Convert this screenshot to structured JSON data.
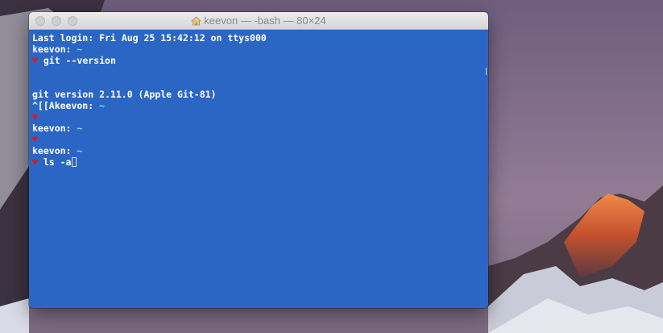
{
  "colors": {
    "terminal_bg": "#2c66c5",
    "text": "#ffffff",
    "tilde": "#7fe0ef",
    "heart": "#c8202a"
  },
  "window": {
    "title": "keevon — -bash — 80×24",
    "title_icon": "home-icon"
  },
  "terminal": {
    "lines": [
      {
        "text": "Last login: Fri Aug 25 15:42:12 on ttys000"
      },
      {
        "prefix": "keevon: ",
        "tilde": "~"
      },
      {
        "heart": "♥",
        "text": " git --version"
      },
      {
        "text": ""
      },
      {
        "text": ""
      },
      {
        "text": "git version 2.11.0 (Apple Git-81)"
      },
      {
        "prefix": "^[[Akeevon: ",
        "tilde": "~"
      },
      {
        "heart": "♥",
        "text": ""
      },
      {
        "prefix": "keevon: ",
        "tilde": "~"
      },
      {
        "heart": "♥",
        "text": ""
      },
      {
        "prefix": "keevon: ",
        "tilde": "~"
      },
      {
        "heart": "♥",
        "text": " ls -a"
      }
    ]
  }
}
